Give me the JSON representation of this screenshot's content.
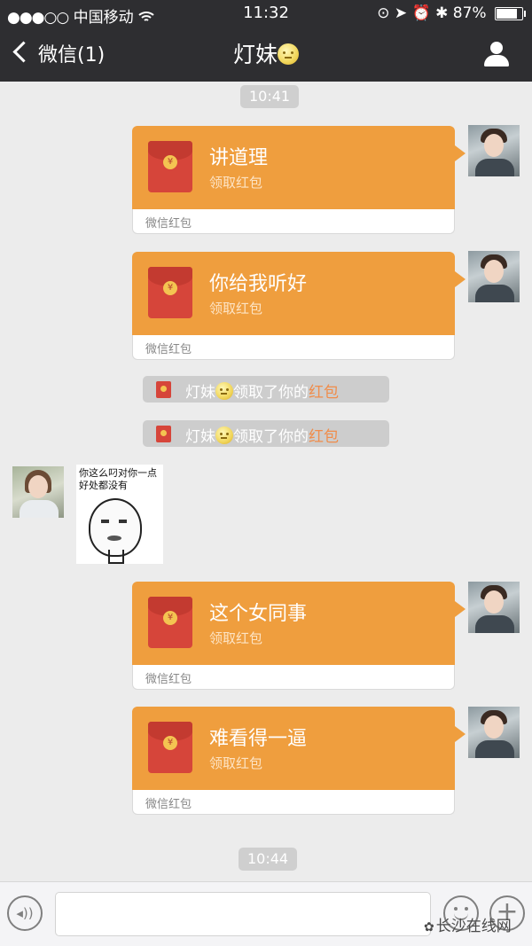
{
  "status_bar": {
    "signal": "●●●○○",
    "carrier": "中国移动",
    "wifi_icon": "wifi-icon",
    "time": "11:32",
    "icons": "⊙ ➤ ⏰ ✱",
    "battery": "87%",
    "battery_level": 0.87
  },
  "nav": {
    "back_label": "微信(1)",
    "title": "灯妹"
  },
  "messages": {
    "time_1": "10:41",
    "time_2": "10:44",
    "packets": [
      {
        "text": "讲道理",
        "sub": "领取红包",
        "footer": "微信红包"
      },
      {
        "text": "你给我听好",
        "sub": "领取红包",
        "footer": "微信红包"
      },
      {
        "text": "这个女同事",
        "sub": "领取红包",
        "footer": "微信红包"
      },
      {
        "text": "难看得一逼",
        "sub": "领取红包",
        "footer": "微信红包"
      }
    ],
    "notices": [
      {
        "name": "灯妹",
        "pre": "领取了你的",
        "highlight": "红包"
      },
      {
        "name": "灯妹",
        "pre": "领取了你的",
        "highlight": "红包"
      }
    ],
    "sticker_caption": "你这么叼对你一点好处都没有"
  },
  "input_bar": {
    "voice_icon": "voice-icon",
    "emoji_icon": "emoji-icon",
    "plus_icon": "plus-icon"
  },
  "watermark": "长沙在线网",
  "colors": {
    "nav_bg": "#2e2e31",
    "packet_orange": "#ef9e3e",
    "packet_red": "#d6453a",
    "highlight": "#f08c4a",
    "chat_bg": "#ececec"
  }
}
